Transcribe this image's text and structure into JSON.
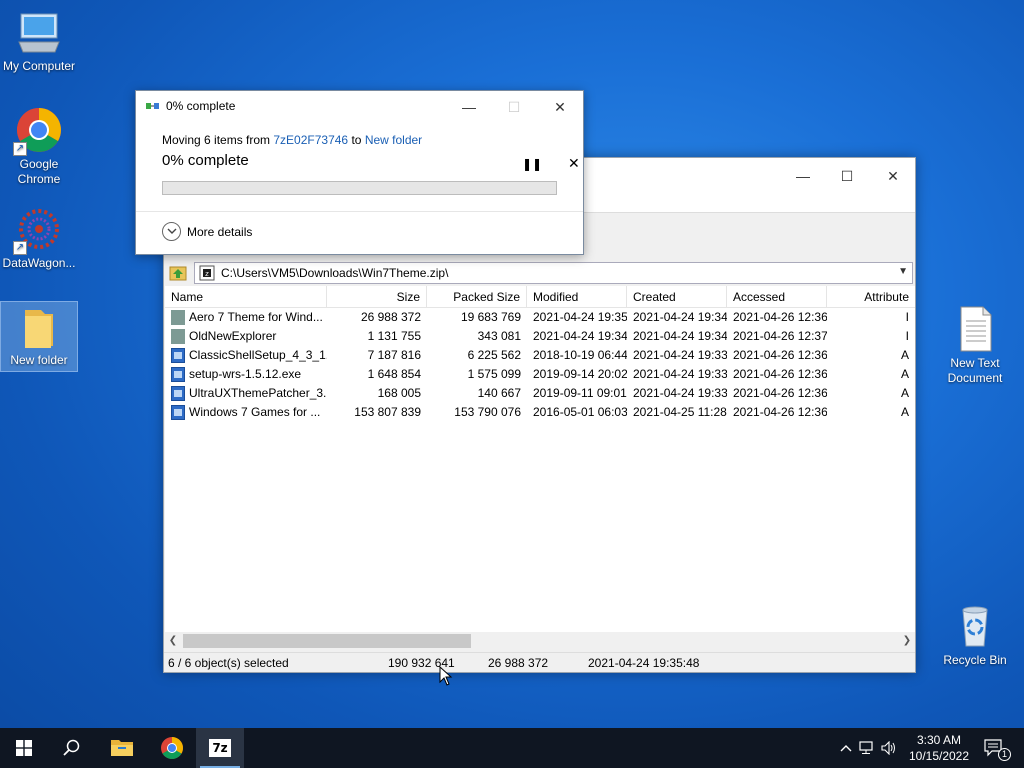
{
  "desktop": {
    "icons": [
      {
        "label": "My Computer"
      },
      {
        "label": "Google Chrome"
      },
      {
        "label": "DataWagon..."
      },
      {
        "label": "New folder"
      },
      {
        "label": "New Text Document"
      },
      {
        "label": "Recycle Bin"
      }
    ]
  },
  "progress_dialog": {
    "title": "0% complete",
    "moving_prefix": "Moving 6 items from",
    "source": "7zE02F73746",
    "to_word": "to",
    "destination": "New folder",
    "percent_text": "0% complete",
    "progress": 0,
    "more_details": "More details",
    "pause_glyph": "❚❚",
    "cancel_glyph": "✕",
    "minimize_glyph": "—",
    "maximize_glyph": "☐",
    "close_glyph": "✕"
  },
  "zip_window": {
    "minimize_glyph": "—",
    "maximize_glyph": "☐",
    "close_glyph": "✕",
    "address": "C:\\Users\\VM5\\Downloads\\Win7Theme.zip\\",
    "columns": [
      "Name",
      "Size",
      "Packed Size",
      "Modified",
      "Created",
      "Accessed",
      "Attribute"
    ],
    "rows": [
      {
        "name": "Aero 7 Theme for Wind...",
        "size": "26 988 372",
        "packed": "19 683 769",
        "modified": "2021-04-24 19:35",
        "created": "2021-04-24 19:34",
        "accessed": "2021-04-26 12:36",
        "attr": "I",
        "type": "folder"
      },
      {
        "name": "OldNewExplorer",
        "size": "1 131 755",
        "packed": "343 081",
        "modified": "2021-04-24 19:34",
        "created": "2021-04-24 19:34",
        "accessed": "2021-04-26 12:37",
        "attr": "I",
        "type": "folder"
      },
      {
        "name": "ClassicShellSetup_4_3_1....",
        "size": "7 187 816",
        "packed": "6 225 562",
        "modified": "2018-10-19 06:44",
        "created": "2021-04-24 19:33",
        "accessed": "2021-04-26 12:36",
        "attr": "A",
        "type": "exe"
      },
      {
        "name": "setup-wrs-1.5.12.exe",
        "size": "1 648 854",
        "packed": "1 575 099",
        "modified": "2019-09-14 20:02",
        "created": "2021-04-24 19:33",
        "accessed": "2021-04-26 12:36",
        "attr": "A",
        "type": "exe"
      },
      {
        "name": "UltraUXThemePatcher_3....",
        "size": "168 005",
        "packed": "140 667",
        "modified": "2019-09-11 09:01",
        "created": "2021-04-24 19:33",
        "accessed": "2021-04-26 12:36",
        "attr": "A",
        "type": "exe"
      },
      {
        "name": "Windows 7 Games for ...",
        "size": "153 807 839",
        "packed": "153 790 076",
        "modified": "2016-05-01 06:03",
        "created": "2021-04-25 11:28",
        "accessed": "2021-04-26 12:36",
        "attr": "A",
        "type": "exe"
      }
    ],
    "status": {
      "selected": "6 / 6 object(s) selected",
      "total_size": "190 932 641",
      "packed_size": "26 988 372",
      "modified": "2021-04-24 19:35:48"
    }
  },
  "taskbar": {
    "time": "3:30 AM",
    "date": "10/15/2022",
    "seven_zip_label": "7z",
    "notification_count": "1"
  }
}
